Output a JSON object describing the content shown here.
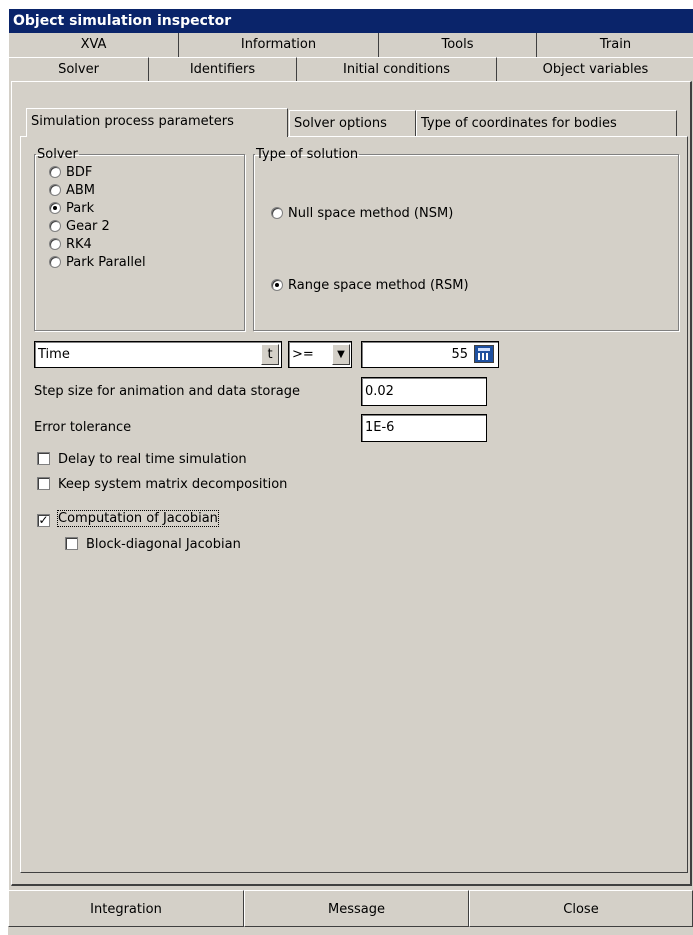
{
  "window": {
    "title": "Object simulation inspector"
  },
  "tabs": {
    "top": [
      "XVA",
      "Information",
      "Tools",
      "Train"
    ],
    "bottom": [
      "Solver",
      "Identifiers",
      "Initial conditions",
      "Object variables"
    ],
    "active": "Solver"
  },
  "subtabs": {
    "items": [
      "Simulation process parameters",
      "Solver options",
      "Type of coordinates for bodies"
    ],
    "active": "Simulation process parameters"
  },
  "solver_group": {
    "legend": "Solver",
    "options": [
      "BDF",
      "ABM",
      "Park",
      "Gear 2",
      "RK4",
      "Park Parallel"
    ],
    "selected": "Park"
  },
  "solution_group": {
    "legend": "Type of solution",
    "options": [
      "Null space method (NSM)",
      "Range space method (RSM)"
    ],
    "selected": "Range space method (RSM)"
  },
  "end_condition": {
    "variable": "Time",
    "variable_button": "t",
    "operator": ">=",
    "dropdown_icon": "triangle-down-icon",
    "value": "55",
    "calculator_icon": "calculator-icon"
  },
  "step_size": {
    "label": "Step size for animation and data storage",
    "value": "0.02"
  },
  "error_tolerance": {
    "label": "Error tolerance",
    "value": "1E-6"
  },
  "checkboxes": [
    {
      "label": "Delay to real time simulation",
      "checked": false
    },
    {
      "label": "Keep system matrix decomposition",
      "checked": false
    },
    {
      "label": "Computation of Jacobian",
      "checked": true
    },
    {
      "label": "Block-diagonal Jacobian",
      "checked": false
    }
  ],
  "bottom_buttons": [
    "Integration",
    "Message",
    "Close"
  ],
  "colors": {
    "titlebar": "#0a246a",
    "face": "#d4d0c8",
    "calculator": "#1e50a0"
  }
}
